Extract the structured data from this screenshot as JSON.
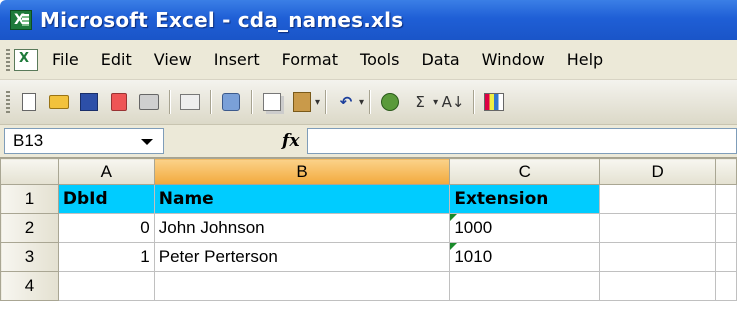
{
  "window": {
    "title": "Microsoft Excel - cda_names.xls"
  },
  "menu": {
    "items": [
      "File",
      "Edit",
      "View",
      "Insert",
      "Format",
      "Tools",
      "Data",
      "Window",
      "Help"
    ]
  },
  "toolbar": {
    "icons": [
      "new-icon",
      "open-icon",
      "save-icon",
      "permission-icon",
      "print-icon",
      "print-preview-icon",
      "research-icon",
      "copy-icon",
      "paste-icon",
      "undo-icon",
      "hyperlink-icon",
      "autosum-icon",
      "sort-ascending-icon",
      "chart-wizard-icon"
    ],
    "autosum_label": "Σ",
    "sort_label": "A↓"
  },
  "formula_bar": {
    "name_box": "B13",
    "fx_label": "fx",
    "formula": ""
  },
  "sheet": {
    "columns": [
      "A",
      "B",
      "C",
      "D"
    ],
    "selected_column": "B",
    "rows": [
      {
        "num": "1",
        "cells": [
          "DbId",
          "Name",
          "Extension",
          ""
        ]
      },
      {
        "num": "2",
        "cells": [
          "0",
          "John Johnson",
          "1000",
          ""
        ]
      },
      {
        "num": "3",
        "cells": [
          "1",
          "Peter Perterson",
          "1010",
          ""
        ]
      },
      {
        "num": "4",
        "cells": [
          "",
          "",
          "",
          ""
        ]
      }
    ]
  }
}
